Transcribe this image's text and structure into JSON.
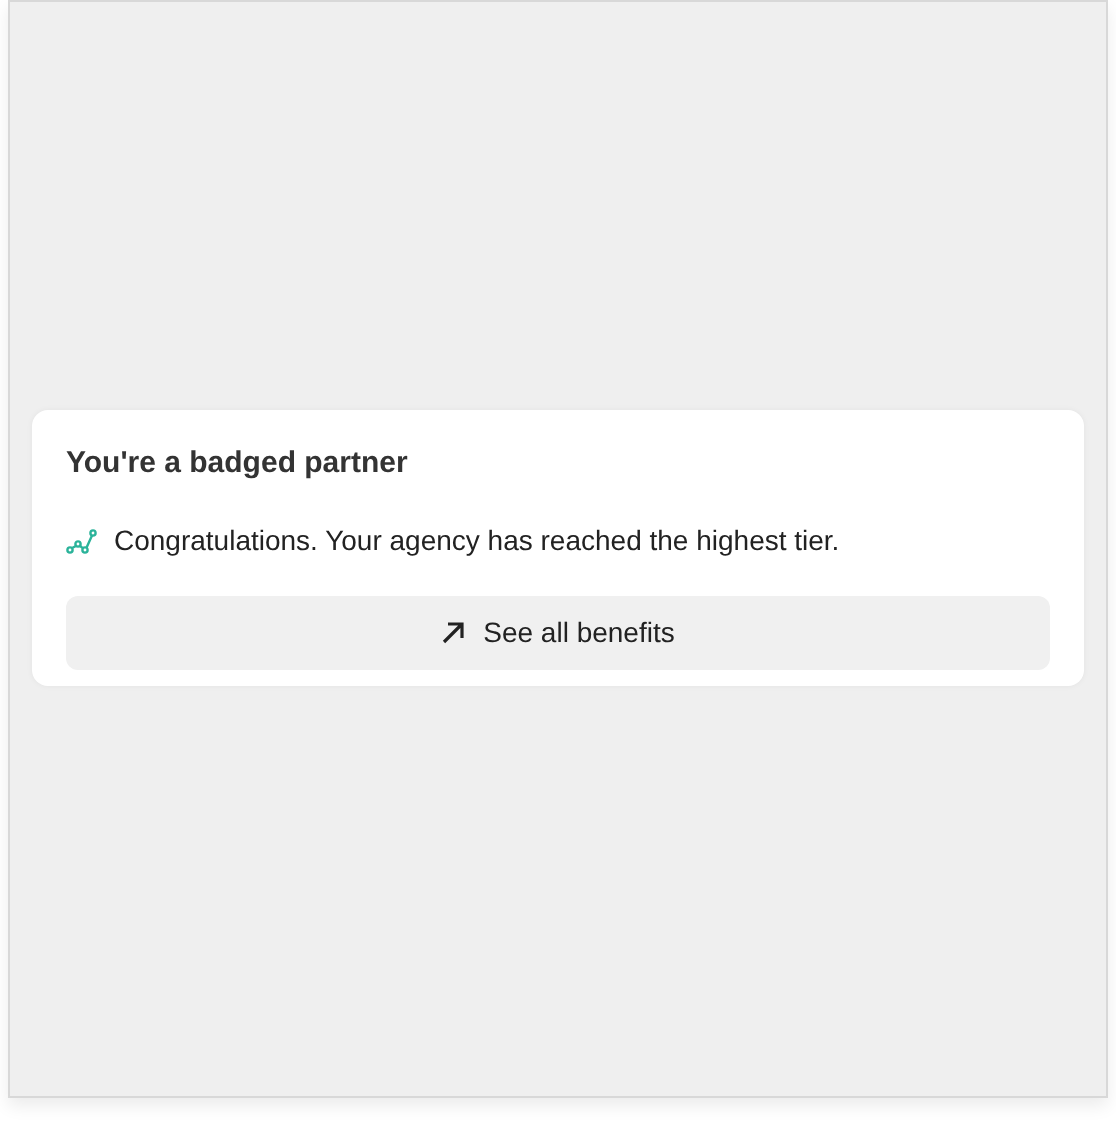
{
  "card": {
    "title": "You're a badged partner",
    "message": "Congratulations. Your agency has reached the highest tier.",
    "button": {
      "label": "See all benefits"
    }
  }
}
